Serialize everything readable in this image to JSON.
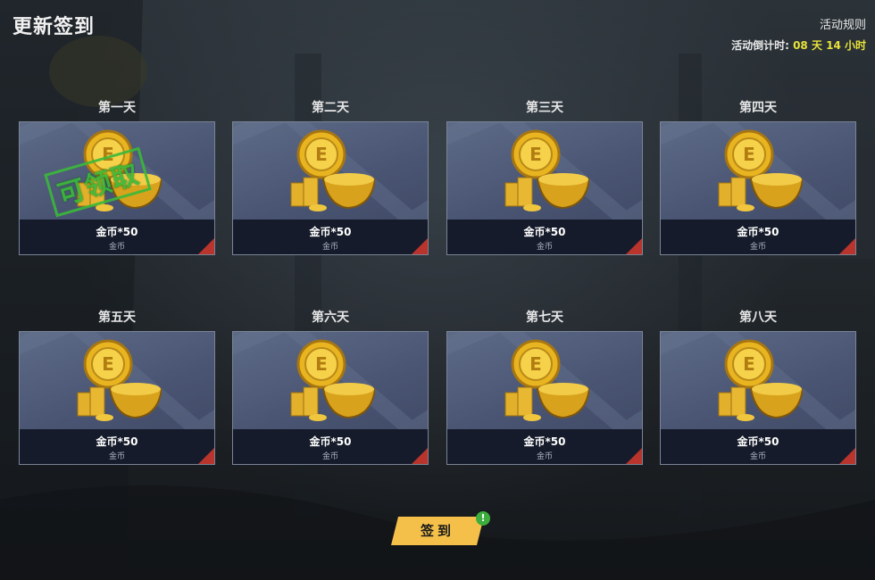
{
  "header": {
    "title": "更新签到",
    "rules_label": "活动规则",
    "countdown_label": "活动倒计时: ",
    "countdown_value": "08 天 14 小时"
  },
  "colors": {
    "accent_yellow": "#f4c04a",
    "countdown_yellow": "#e8e23a",
    "stamp_green": "#3ab93a",
    "corner_red": "#b8342c"
  },
  "days": [
    {
      "label": "第一天",
      "reward": "金币*50",
      "type": "金币",
      "icon": "gold-coins-bowl-icon",
      "stamp": "可领取"
    },
    {
      "label": "第二天",
      "reward": "金币*50",
      "type": "金币",
      "icon": "gold-coins-bowl-icon"
    },
    {
      "label": "第三天",
      "reward": "金币*50",
      "type": "金币",
      "icon": "gold-coins-bowl-icon"
    },
    {
      "label": "第四天",
      "reward": "金币*50",
      "type": "金币",
      "icon": "gold-coins-bowl-icon"
    },
    {
      "label": "第五天",
      "reward": "金币*50",
      "type": "金币",
      "icon": "gold-coins-bowl-icon"
    },
    {
      "label": "第六天",
      "reward": "金币*50",
      "type": "金币",
      "icon": "gold-coins-bowl-icon"
    },
    {
      "label": "第七天",
      "reward": "金币*50",
      "type": "金币",
      "icon": "gold-coins-bowl-icon"
    },
    {
      "label": "第八天",
      "reward": "金币*50",
      "type": "金币",
      "icon": "gold-coins-bowl-icon"
    }
  ],
  "signin_button": {
    "label": "签到",
    "badge": "!"
  }
}
